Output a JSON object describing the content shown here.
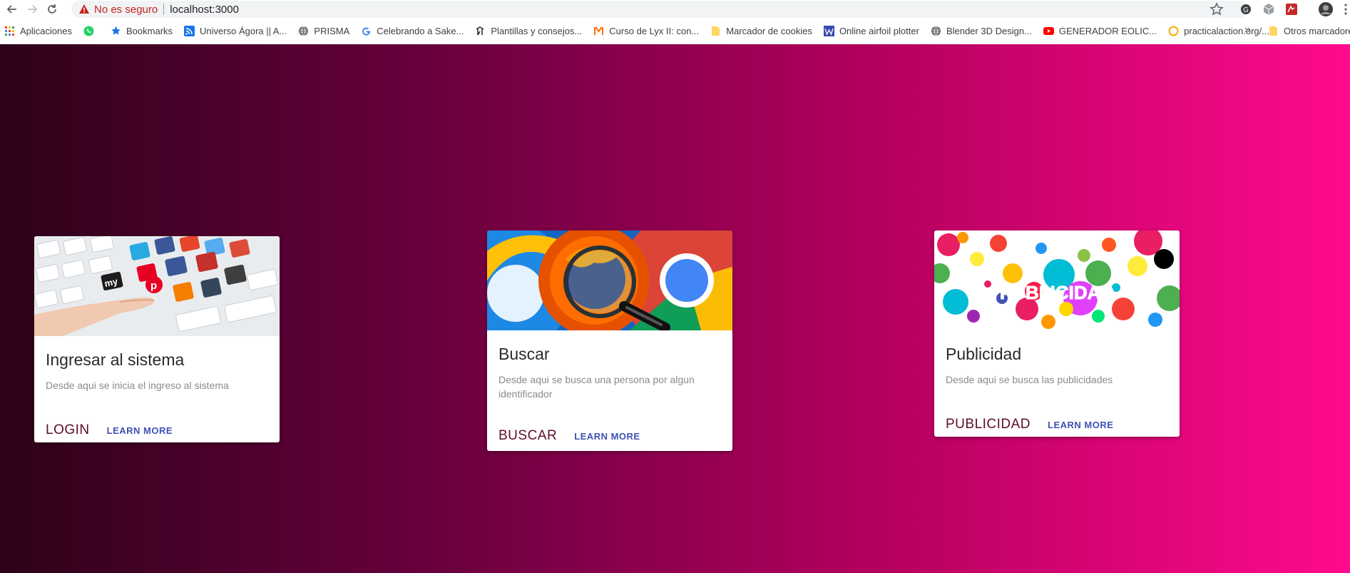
{
  "browser": {
    "security_label": "No es seguro",
    "url": "localhost:3000"
  },
  "bookmarks": [
    {
      "label": "Aplicaciones",
      "icon": "apps-grid-icon",
      "color": "#ea4335"
    },
    {
      "label": "",
      "icon": "whatsapp-icon",
      "color": "#25d366"
    },
    {
      "label": "Bookmarks",
      "icon": "star-icon",
      "color": "#1a73e8"
    },
    {
      "label": "Universo Ágora || A...",
      "icon": "rss-icon",
      "color": "#1a73e8"
    },
    {
      "label": "PRISMA",
      "icon": "globe-icon",
      "color": "#5f6368"
    },
    {
      "label": "Celebrando a Sake...",
      "icon": "google-icon",
      "color": "#4285f4"
    },
    {
      "label": "Plantillas y consejos...",
      "icon": "figure-icon",
      "color": "#202124"
    },
    {
      "label": "Curso de Lyx II: con...",
      "icon": "m-icon",
      "color": "#ff6d00"
    },
    {
      "label": "Marcador de cookies",
      "icon": "folder-icon",
      "color": "#fdd663"
    },
    {
      "label": "Online airfoil plotter",
      "icon": "w-icon",
      "color": "#3949ab"
    },
    {
      "label": "Blender 3D Design...",
      "icon": "globe-icon",
      "color": "#5f6368"
    },
    {
      "label": "GENERADOR EOLIC...",
      "icon": "youtube-icon",
      "color": "#ff0000"
    },
    {
      "label": "practicalaction.org/...",
      "icon": "circle-icon",
      "color": "#f9ab00"
    }
  ],
  "bookmarks_more": "»",
  "other_bookmarks": "Otros marcadore",
  "cards": {
    "login": {
      "title": "Ingresar al sistema",
      "description": "Desde aqui se inicia el ingreso al sistema",
      "action": "LOGIN",
      "learn": "LEARN MORE"
    },
    "buscar": {
      "title": "Buscar",
      "description": "Desde aqui se busca una persona por algun identificador",
      "action": "BUSCAR",
      "learn": "LEARN MORE"
    },
    "publicidad": {
      "title": "Publicidad",
      "description": "Desde aqui se busca las publicidades",
      "action": "PUBLICIDAD",
      "learn": "LEARN MORE",
      "image_text": "PUBLICIDAD"
    }
  },
  "colors": {
    "gradient_start": "#2e0219",
    "gradient_end": "#ff0a8e",
    "action_color": "#5d0d25",
    "learn_color": "#3f51b5"
  }
}
